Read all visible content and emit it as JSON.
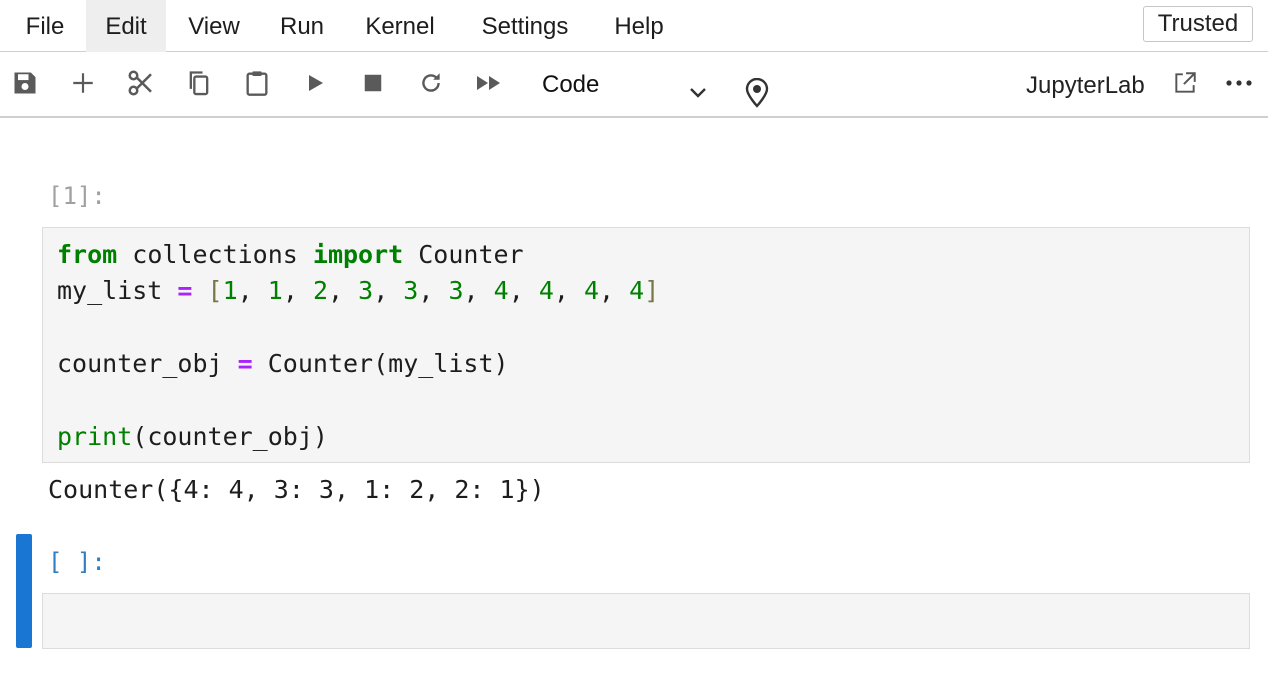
{
  "menubar": {
    "items": [
      "File",
      "Edit",
      "View",
      "Run",
      "Kernel",
      "Settings",
      "Help"
    ],
    "active_index": 1,
    "trusted_label": "Trusted"
  },
  "toolbar": {
    "buttons": [
      {
        "name": "save",
        "icon": "save-icon"
      },
      {
        "name": "insert-cell",
        "icon": "plus-icon"
      },
      {
        "name": "cut",
        "icon": "scissors-icon"
      },
      {
        "name": "copy",
        "icon": "copy-icon"
      },
      {
        "name": "paste",
        "icon": "clipboard-icon"
      },
      {
        "name": "run",
        "icon": "play-icon"
      },
      {
        "name": "interrupt",
        "icon": "stop-icon"
      },
      {
        "name": "restart",
        "icon": "restart-icon"
      },
      {
        "name": "restart-run-all",
        "icon": "fast-forward-icon"
      }
    ],
    "cell_type": "Code",
    "jupyterlab_label": "JupyterLab"
  },
  "notebook": {
    "cells": [
      {
        "prompt": "[1]:",
        "code_lines": [
          "from collections import Counter",
          "my_list = [1, 1, 2, 3, 3, 3, 4, 4, 4, 4]",
          "",
          "counter_obj = Counter(my_list)",
          "",
          "print(counter_obj)"
        ],
        "output": "Counter({4: 4, 3: 3, 1: 2, 2: 1})"
      },
      {
        "prompt": "[ ]:",
        "code_lines": []
      }
    ]
  },
  "colors": {
    "keyword": "#008000",
    "operator": "#aa22ff",
    "active_cell": "#1976d2",
    "prompt_inactive": "#a0a0a0",
    "prompt_active": "#307fc1"
  }
}
